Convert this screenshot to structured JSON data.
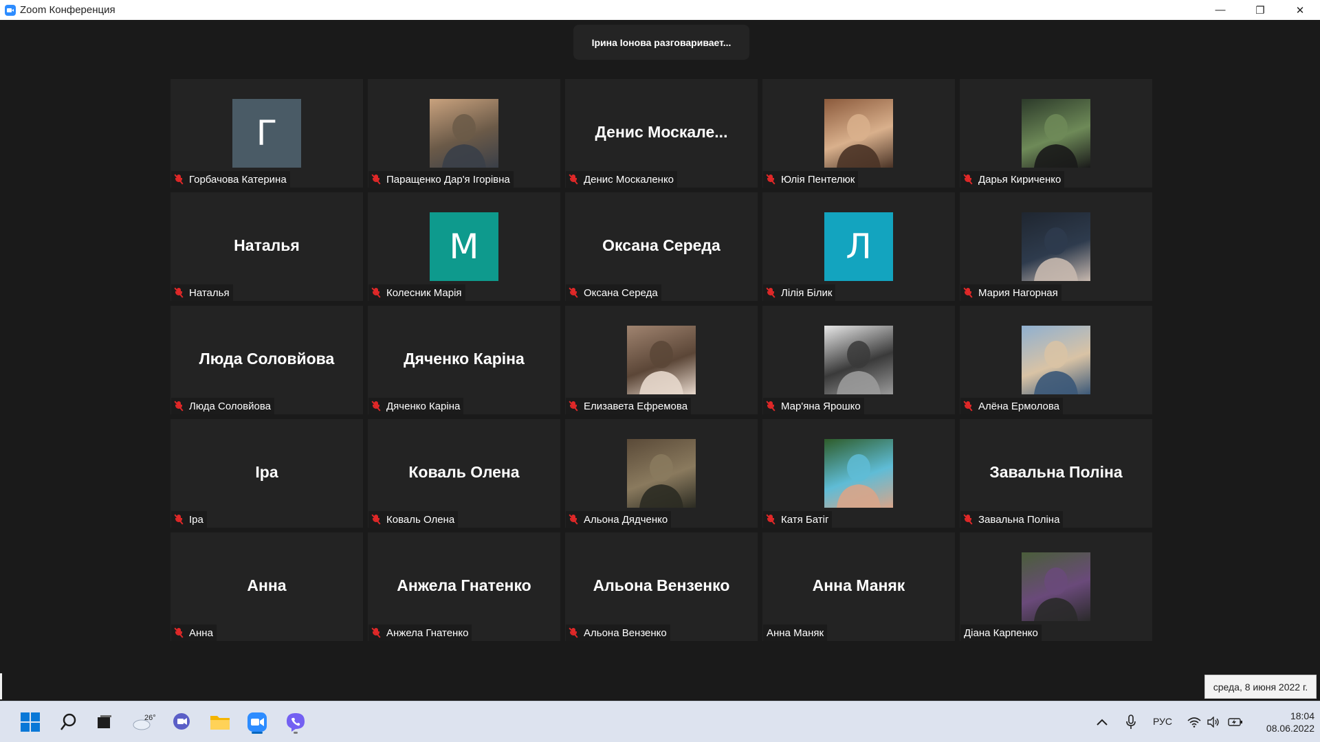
{
  "window": {
    "title": "Zoom Конференция",
    "minimize": "—",
    "restore": "❐",
    "close": "✕"
  },
  "speaker": "Ірина Іонова разговаривает...",
  "colors": {
    "accent": "#2d8cff",
    "mic_muted": "#e02828"
  },
  "participants": [
    {
      "name": "Горбачова Катерина",
      "display": "letter",
      "letter": "Г",
      "bg": "#4a5b66",
      "muted": true
    },
    {
      "name": "Паращенко Дар'я Ігорівна",
      "display": "photo",
      "muted": true
    },
    {
      "name": "Денис Москаленко",
      "display": "name",
      "big": "Денис  Москале...",
      "muted": true
    },
    {
      "name": "Юлія Пентелюк",
      "display": "photo",
      "muted": true
    },
    {
      "name": "Дарья Кириченко",
      "display": "photo",
      "muted": true
    },
    {
      "name": "Наталья",
      "display": "name",
      "big": "Наталья",
      "muted": true
    },
    {
      "name": "Колесник Марія",
      "display": "letter",
      "letter": "М",
      "bg": "#0e9a8d",
      "muted": true
    },
    {
      "name": "Оксана Середа",
      "display": "name",
      "big": "Оксана Середа",
      "muted": true
    },
    {
      "name": "Лілія Білик",
      "display": "letter",
      "letter": "Л",
      "bg": "#13a4bf",
      "muted": true
    },
    {
      "name": "Мария Нагорная",
      "display": "photo",
      "muted": true
    },
    {
      "name": "Люда Соловйова",
      "display": "name",
      "big": "Люда Соловйова",
      "muted": true
    },
    {
      "name": "Дяченко Каріна",
      "display": "name",
      "big": "Дяченко Каріна",
      "muted": true
    },
    {
      "name": "Елизавета Ефремова",
      "display": "photo",
      "muted": true
    },
    {
      "name": "Мар'яна Ярошко",
      "display": "photo",
      "muted": true
    },
    {
      "name": "Алёна Ермолова",
      "display": "photo",
      "muted": true
    },
    {
      "name": "Іра",
      "display": "name",
      "big": "Іра",
      "muted": true
    },
    {
      "name": "Коваль Олена",
      "display": "name",
      "big": "Коваль Олена",
      "muted": true
    },
    {
      "name": "Альона Дядченко",
      "display": "photo",
      "muted": true
    },
    {
      "name": "Катя Батіг",
      "display": "photo",
      "muted": true
    },
    {
      "name": "Завальна Поліна",
      "display": "name",
      "big": "Завальна Поліна",
      "muted": true
    },
    {
      "name": "Анна",
      "display": "name",
      "big": "Анна",
      "muted": true
    },
    {
      "name": "Анжела Гнатенко",
      "display": "name",
      "big": "Анжела Гнатенко",
      "muted": true
    },
    {
      "name": "Альона Вензенко",
      "display": "name",
      "big": "Альона Вензенко",
      "muted": true
    },
    {
      "name": "Анна Маняк",
      "display": "name",
      "big": "Анна Маняк",
      "muted": false
    },
    {
      "name": "Діана Карпенко",
      "display": "photo",
      "muted": false
    }
  ],
  "date_tooltip": "среда, 8 июня 2022 г.",
  "taskbar": {
    "weather_temp": "26°",
    "language": "РУС",
    "time": "18:04",
    "date": "08.06.2022"
  }
}
